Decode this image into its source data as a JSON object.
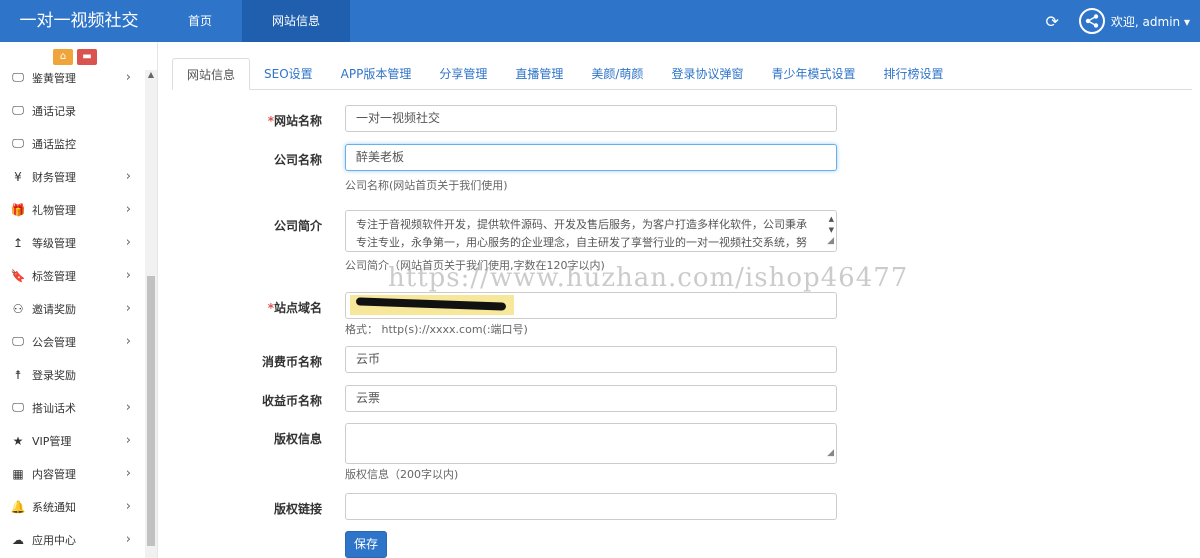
{
  "brand": "一对一视频社交",
  "topnav": [
    {
      "label": "首页"
    },
    {
      "label": "网站信息"
    }
  ],
  "header": {
    "welcome": "欢迎, admin ▾"
  },
  "sidebar": {
    "items": [
      {
        "label": "鉴黄管理",
        "icon": "monitor-icon",
        "arrow": true
      },
      {
        "label": "通话记录",
        "icon": "monitor-icon",
        "arrow": false
      },
      {
        "label": "通话监控",
        "icon": "monitor-icon",
        "arrow": false
      },
      {
        "label": "财务管理",
        "icon": "yen-icon",
        "arrow": true
      },
      {
        "label": "礼物管理",
        "icon": "gift-icon",
        "arrow": true
      },
      {
        "label": "等级管理",
        "icon": "level-up-icon",
        "arrow": true
      },
      {
        "label": "标签管理",
        "icon": "bookmark-icon",
        "arrow": true
      },
      {
        "label": "邀请奖励",
        "icon": "sitemap-icon",
        "arrow": true
      },
      {
        "label": "公会管理",
        "icon": "monitor-icon",
        "arrow": true
      },
      {
        "label": "登录奖励",
        "icon": "child-icon",
        "arrow": false
      },
      {
        "label": "搭讪话术",
        "icon": "monitor-icon",
        "arrow": true
      },
      {
        "label": "VIP管理",
        "icon": "star-icon",
        "arrow": true
      },
      {
        "label": "内容管理",
        "icon": "grid-icon",
        "arrow": true
      },
      {
        "label": "系统通知",
        "icon": "bell-icon",
        "arrow": true
      },
      {
        "label": "应用中心",
        "icon": "cloud-icon",
        "arrow": true
      }
    ]
  },
  "tabs": [
    {
      "label": "网站信息"
    },
    {
      "label": "SEO设置"
    },
    {
      "label": "APP版本管理"
    },
    {
      "label": "分享管理"
    },
    {
      "label": "直播管理"
    },
    {
      "label": "美颜/萌颜"
    },
    {
      "label": "登录协议弹窗"
    },
    {
      "label": "青少年模式设置"
    },
    {
      "label": "排行榜设置"
    }
  ],
  "form": {
    "site_name": {
      "label": "网站名称",
      "value": "一对一视频社交"
    },
    "company_name": {
      "label": "公司名称",
      "value": "醉美老板",
      "help": "公司名称(网站首页关于我们使用)"
    },
    "company_intro": {
      "label": "公司简介",
      "value": "专注于音视频软件开发，提供软件源码、开发及售后服务，为客户打造多样化软件，公司秉承专注专业，永争第一，用心服务的企业理念，自主研发了享誉行业的一对一视频社交系统，努",
      "help": "公司简介（网站首页关于我们使用,字数在120字以内)"
    },
    "site_domain": {
      "label": "站点域名",
      "help": "格式：  http(s)://xxxx.com(:端口号)"
    },
    "coin_name": {
      "label": "消费币名称",
      "value": "云币"
    },
    "income_coin_name": {
      "label": "收益币名称",
      "value": "云票"
    },
    "copyright": {
      "label": "版权信息",
      "help": "版权信息（200字以内)"
    },
    "copyright_link": {
      "label": "版权链接"
    },
    "save_label": "保存"
  },
  "watermark": "https://www.huzhan.com/ishop46477"
}
